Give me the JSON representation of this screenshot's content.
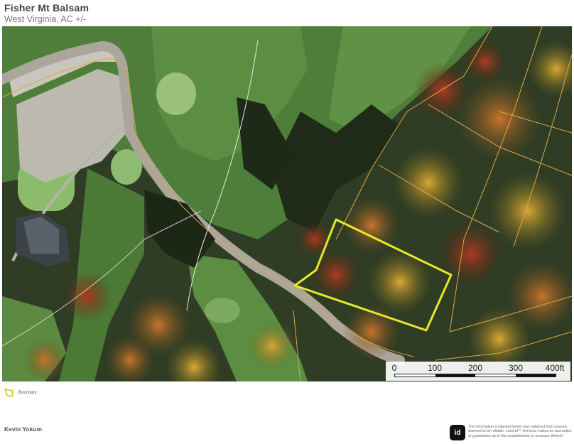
{
  "header": {
    "title": "Fisher Mt Balsam",
    "subtitle": "West Virginia,  AC +/-"
  },
  "scale": {
    "labels": [
      "0",
      "100",
      "200",
      "300",
      "400ft"
    ]
  },
  "legend": {
    "items": [
      {
        "label": "Boundary",
        "color": "#e8e82a"
      }
    ]
  },
  "footer": {
    "author": "Kevin Yokum",
    "logo_text": "id",
    "disclaimer": "The information contained herein was obtained from sources deemed to be reliable. Land.id™ Services makes no warranties or guarantees as to the completeness or accuracy thereof."
  },
  "colors": {
    "boundary": "#e8e82a",
    "parcel_lines": "#e0a84a",
    "road": "#b9b6ad",
    "fairway": "#5f8c45",
    "forest": "#2c3a22"
  }
}
